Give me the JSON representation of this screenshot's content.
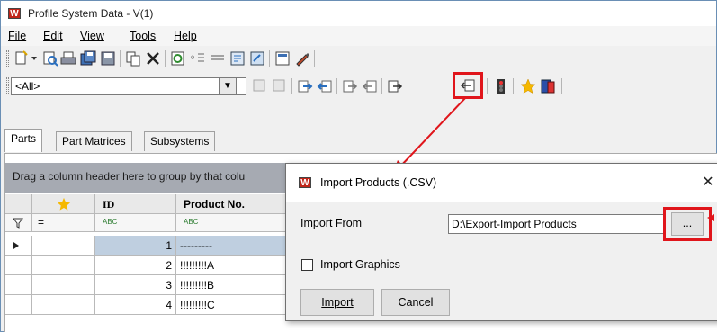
{
  "window": {
    "title": "Profile System Data - V(1)",
    "logo_letter": "W"
  },
  "menu": {
    "file": "File",
    "edit": "Edit",
    "view": "View",
    "tools": "Tools",
    "help": "Help"
  },
  "filter_combo": {
    "value": "<All>",
    "arrow": "▼"
  },
  "tabs": [
    {
      "label": "Parts",
      "active": true
    },
    {
      "label": "Part Matrices",
      "active": false
    },
    {
      "label": "Subsystems",
      "active": false
    }
  ],
  "grid": {
    "group_hint": "Drag a column header here to group by that colu",
    "headers": {
      "favorite": "★",
      "id": "ID",
      "product_no": "Product No."
    },
    "filter_row": {
      "equals": "=",
      "abc1": "ABC",
      "abc2": "ABC"
    },
    "rows": [
      {
        "id": "1",
        "product_no": "---------"
      },
      {
        "id": "2",
        "product_no": "!!!!!!!!!A"
      },
      {
        "id": "3",
        "product_no": "!!!!!!!!!B"
      },
      {
        "id": "4",
        "product_no": "!!!!!!!!!C"
      }
    ]
  },
  "dialog": {
    "title": "Import Products (.CSV)",
    "close": "✕",
    "import_from_label": "Import From",
    "import_from_value": "D:\\Export-Import Products",
    "browse_label": "...",
    "import_graphics_label": "Import Graphics",
    "import_graphics_checked": false,
    "import_button": "Import",
    "cancel_button": "Cancel"
  },
  "colors": {
    "highlight": "#e0151b",
    "selection": "#bfcfe0",
    "star": "#f5b800"
  }
}
